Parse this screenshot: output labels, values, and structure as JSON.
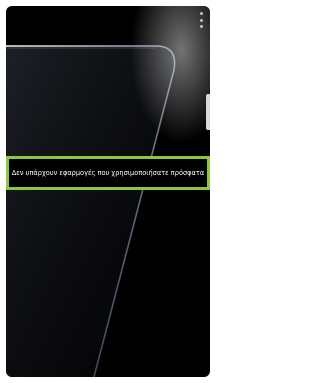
{
  "recents": {
    "empty_message": "Δεν υπάρχουν εφαρμογές που χρησιμοποιήσατε πρόσφατα"
  },
  "toolbar": {
    "menu_icon": "more-vert-icon"
  },
  "colors": {
    "screen_background": "#000000",
    "highlight_border": "#8dc63f",
    "text": "#ffffff"
  }
}
